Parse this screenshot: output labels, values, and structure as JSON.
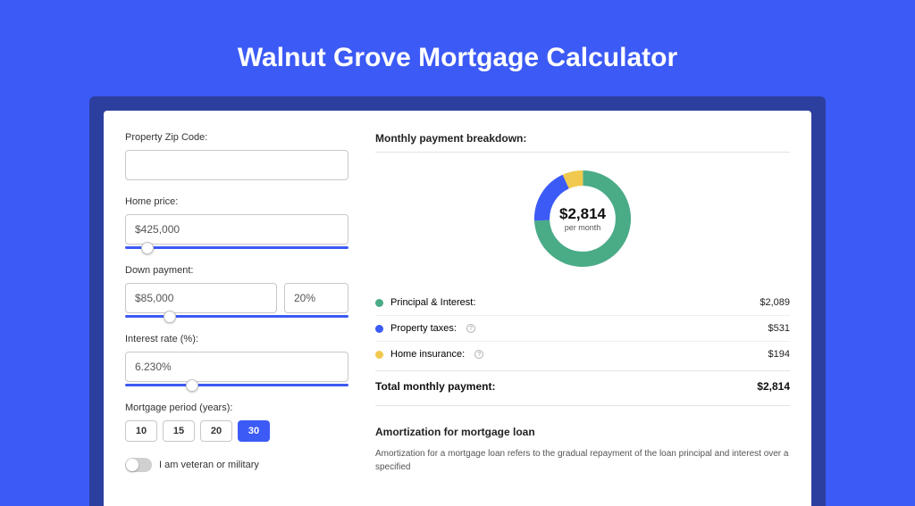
{
  "title": "Walnut Grove Mortgage Calculator",
  "colors": {
    "principal": "#4aab87",
    "taxes": "#3c5af5",
    "insurance": "#f0c94e"
  },
  "fields": {
    "zip": {
      "label": "Property Zip Code:",
      "value": ""
    },
    "price": {
      "label": "Home price:",
      "value": "$425,000",
      "slider_pct": 10
    },
    "down": {
      "label": "Down payment:",
      "value": "$85,000",
      "pct_value": "20%",
      "slider_pct": 20
    },
    "rate": {
      "label": "Interest rate (%):",
      "value": "6.230%",
      "slider_pct": 30
    },
    "period": {
      "label": "Mortgage period (years):",
      "options": [
        "10",
        "15",
        "20",
        "30"
      ],
      "selected": "30"
    },
    "veteran": {
      "label": "I am veteran or military",
      "checked": false
    }
  },
  "breakdown": {
    "title": "Monthly payment breakdown:",
    "center_value": "$2,814",
    "center_unit": "per month",
    "items": [
      {
        "label": "Principal & Interest:",
        "value": "$2,089",
        "color": "#4aab87",
        "info": false
      },
      {
        "label": "Property taxes:",
        "value": "$531",
        "color": "#3c5af5",
        "info": true
      },
      {
        "label": "Home insurance:",
        "value": "$194",
        "color": "#f0c94e",
        "info": true
      }
    ],
    "total_label": "Total monthly payment:",
    "total_value": "$2,814"
  },
  "chart_data": {
    "type": "pie",
    "title": "Monthly payment breakdown",
    "categories": [
      "Principal & Interest",
      "Property taxes",
      "Home insurance"
    ],
    "values": [
      2089,
      531,
      194
    ],
    "total": 2814,
    "unit": "USD/month"
  },
  "amortization": {
    "title": "Amortization for mortgage loan",
    "text": "Amortization for a mortgage loan refers to the gradual repayment of the loan principal and interest over a specified"
  }
}
